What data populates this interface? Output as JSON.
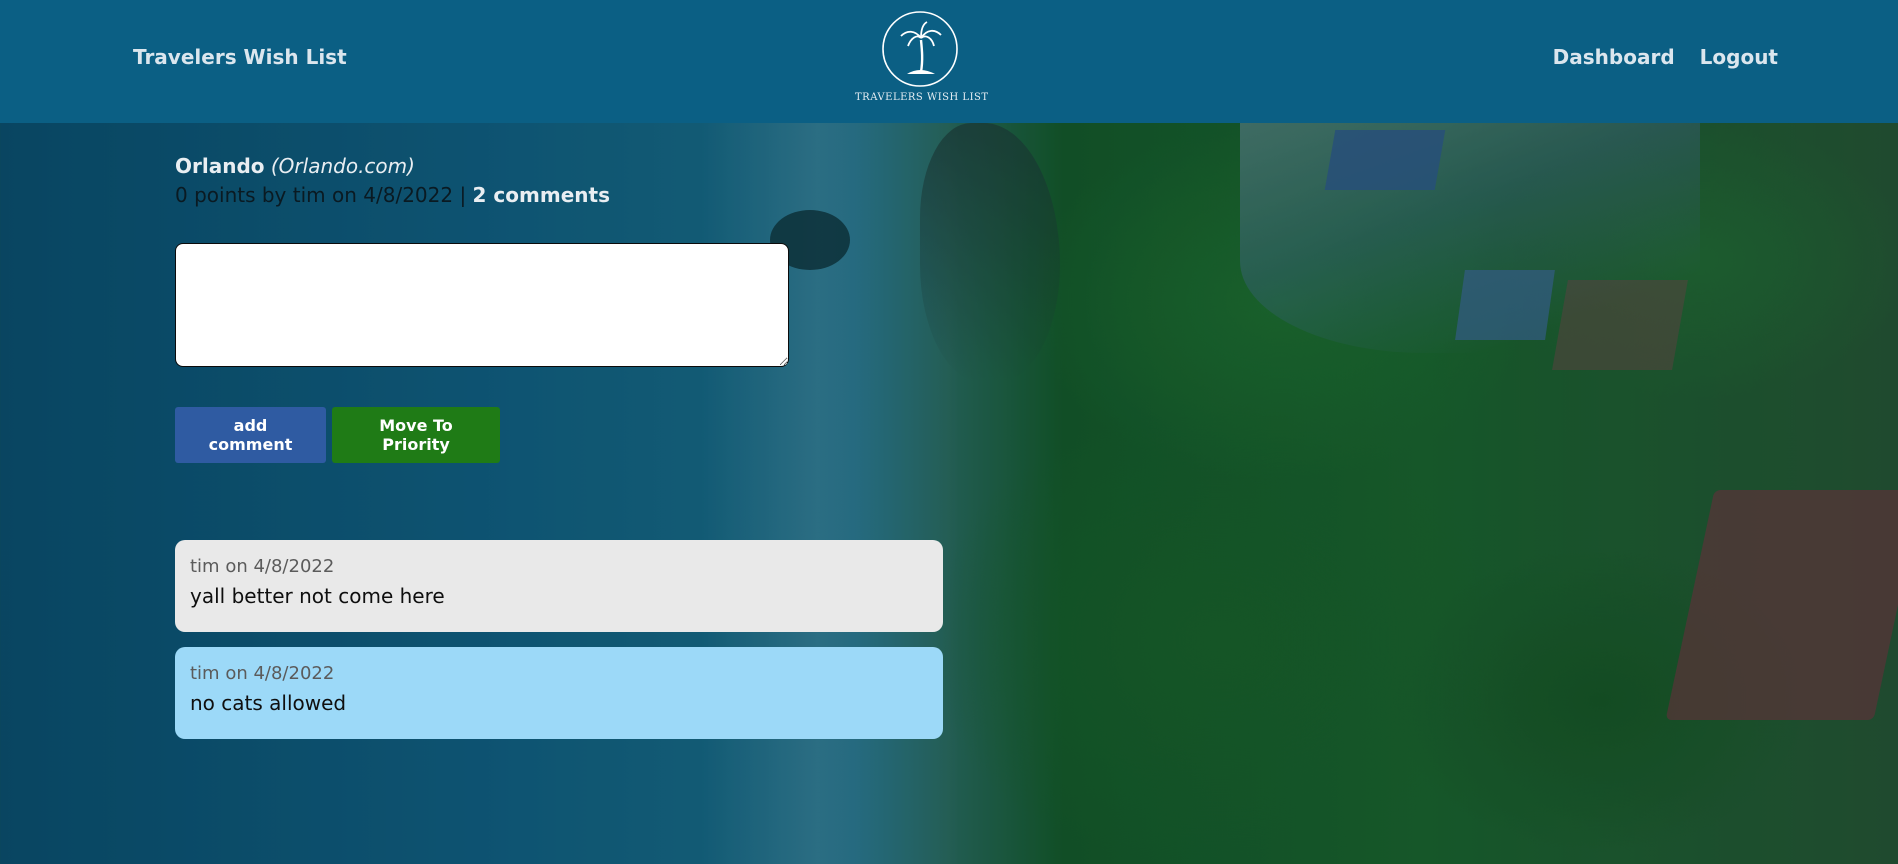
{
  "header": {
    "brand": "Travelers Wish List",
    "logo_caption": "TRAVELERS WISH LIST",
    "nav": [
      {
        "label": "Dashboard"
      },
      {
        "label": "Logout"
      }
    ],
    "background_color": "#0b5f84"
  },
  "post": {
    "title": "Orlando",
    "domain": "(Orlando.com)",
    "meta_prefix": "0 points by tim on 4/8/2022 | ",
    "comments_link": "2 comments"
  },
  "comment_form": {
    "textarea_value": "",
    "add_button": "add comment",
    "priority_button": "Move To Priority",
    "add_button_color": "#2f5ba2",
    "priority_button_color": "#1f7b16"
  },
  "comments": [
    {
      "meta": "tim on 4/8/2022",
      "text": "yall better not come here",
      "color": "#e9e9e9"
    },
    {
      "meta": "tim on 4/8/2022",
      "text": "no cats allowed",
      "color": "#9cd9f8"
    }
  ],
  "icons": {
    "logo": "palm-tree-island-icon"
  }
}
